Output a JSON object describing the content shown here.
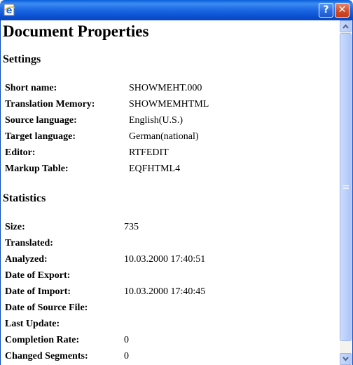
{
  "window": {
    "icon": "ie-document-icon",
    "help_glyph": "?",
    "close_glyph": "✕"
  },
  "page": {
    "title": "Document Properties",
    "settings": {
      "heading": "Settings",
      "rows": [
        {
          "label": "Short name:",
          "value": "SHOWMEHT.000"
        },
        {
          "label": "Translation Memory:",
          "value": "SHOWMEMHTML"
        },
        {
          "label": "Source language:",
          "value": "English(U.S.)"
        },
        {
          "label": "Target language:",
          "value": "German(national)"
        },
        {
          "label": "Editor:",
          "value": "RTFEDIT"
        },
        {
          "label": "Markup Table:",
          "value": "EQFHTML4"
        }
      ]
    },
    "statistics": {
      "heading": "Statistics",
      "rows": [
        {
          "label": "Size:",
          "value": "735"
        },
        {
          "label": "Translated:",
          "value": ""
        },
        {
          "label": "Analyzed:",
          "value": "10.03.2000 17:40:51"
        },
        {
          "label": "Date of Export:",
          "value": ""
        },
        {
          "label": "Date of Import:",
          "value": "10.03.2000 17:40:45"
        },
        {
          "label": "Date of Source File:",
          "value": ""
        },
        {
          "label": "Last Update:",
          "value": ""
        },
        {
          "label": "Completion Rate:",
          "value": "0"
        },
        {
          "label": "Changed Segments:",
          "value": "0"
        }
      ]
    }
  },
  "colors": {
    "titlebar": "#0a50d2",
    "close_button": "#d34a28",
    "scrollbar": "#bcd0fb"
  }
}
